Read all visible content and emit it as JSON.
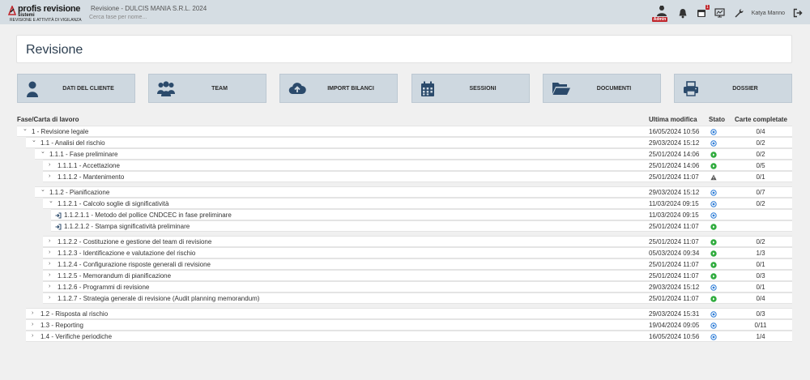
{
  "header": {
    "logo_brand": "profis revisione",
    "logo_sub": "sistemi",
    "logo_tag": "REVISIONE E ATTIVITÀ DI VIGILANZA",
    "app_title": "Revisione - DULCIS MANIA S.R.L. 2024",
    "search_placeholder": "Cerca fase per nome...",
    "admin_label": "Admin",
    "notif_count": "1",
    "user_name": "Katya Manno"
  },
  "page": {
    "title": "Revisione"
  },
  "nav": [
    {
      "label": "DATI DEL CLIENTE",
      "icon": "user-icon"
    },
    {
      "label": "TEAM",
      "icon": "team-icon"
    },
    {
      "label": "IMPORT BILANCI",
      "icon": "cloud-upload-icon"
    },
    {
      "label": "SESSIONI",
      "icon": "calendar-icon"
    },
    {
      "label": "DOCUMENTI",
      "icon": "folder-open-icon"
    },
    {
      "label": "DOSSIER",
      "icon": "printer-icon"
    }
  ],
  "table": {
    "headers": {
      "phase": "Fase/Carta di lavoro",
      "modified": "Ultima modifica",
      "status": "Stato",
      "completed": "Carte completate"
    },
    "status_colors": {
      "pending": "#2b7bd6",
      "done": "#2eab3c",
      "warning": "#555555"
    },
    "rows": [
      {
        "label": "1 - Revisione legale",
        "date": "16/05/2024 10:56",
        "status": "pending",
        "completed": "0/4",
        "chev": "⌄"
      },
      {
        "label": "1.1 - Analisi del rischio",
        "date": "29/03/2024 15:12",
        "status": "pending",
        "completed": "0/2",
        "chev": "⌄"
      },
      {
        "label": "1.1.1 - Fase preliminare",
        "date": "25/01/2024 14:06",
        "status": "done",
        "completed": "0/2",
        "chev": "⌄"
      },
      {
        "label": "1.1.1.1 - Accettazione",
        "date": "25/01/2024 14:06",
        "status": "done",
        "completed": "0/5",
        "chev": "›"
      },
      {
        "label": "1.1.1.2 - Mantenimento",
        "date": "25/01/2024 11:07",
        "status": "warning",
        "completed": "0/1",
        "chev": "›"
      },
      {
        "label": "1.1.2 - Pianificazione",
        "date": "29/03/2024 15:12",
        "status": "pending",
        "completed": "0/7",
        "chev": "⌄"
      },
      {
        "label": "1.1.2.1 - Calcolo soglie di significatività",
        "date": "11/03/2024 09:15",
        "status": "pending",
        "completed": "0/2",
        "chev": "⌄"
      },
      {
        "label": "1.1.2.1.1 - Metodo del pollice CNDCEC in fase preliminare",
        "date": "11/03/2024 09:15",
        "status": "pending",
        "completed": "",
        "chev": ""
      },
      {
        "label": "1.1.2.1.2 - Stampa significatività preliminare",
        "date": "25/01/2024 11:07",
        "status": "done",
        "completed": "",
        "chev": ""
      },
      {
        "label": "1.1.2.2 - Costituzione e gestione del team di revisione",
        "date": "25/01/2024 11:07",
        "status": "done",
        "completed": "0/2",
        "chev": "›"
      },
      {
        "label": "1.1.2.3 - Identificazione e valutazione del rischio",
        "date": "05/03/2024 09:34",
        "status": "done",
        "completed": "1/3",
        "chev": "›"
      },
      {
        "label": "1.1.2.4 - Configurazione risposte generali di revisione",
        "date": "25/01/2024 11:07",
        "status": "done",
        "completed": "0/1",
        "chev": "›"
      },
      {
        "label": "1.1.2.5 - Memorandum di pianificazione",
        "date": "25/01/2024 11:07",
        "status": "done",
        "completed": "0/3",
        "chev": "›"
      },
      {
        "label": "1.1.2.6 - Programmi di revisione",
        "date": "29/03/2024 15:12",
        "status": "pending",
        "completed": "0/1",
        "chev": "›"
      },
      {
        "label": "1.1.2.7 - Strategia generale di revisione (Audit planning memorandum)",
        "date": "25/01/2024 11:07",
        "status": "done",
        "completed": "0/4",
        "chev": "›"
      },
      {
        "label": "1.2 - Risposta al rischio",
        "date": "29/03/2024 15:31",
        "status": "pending",
        "completed": "0/3",
        "chev": "›"
      },
      {
        "label": "1.3 - Reporting",
        "date": "19/04/2024 09:05",
        "status": "pending",
        "completed": "0/11",
        "chev": "›"
      },
      {
        "label": "1.4 - Verifiche periodiche",
        "date": "16/05/2024 10:56",
        "status": "pending",
        "completed": "1/4",
        "chev": "›"
      }
    ]
  }
}
